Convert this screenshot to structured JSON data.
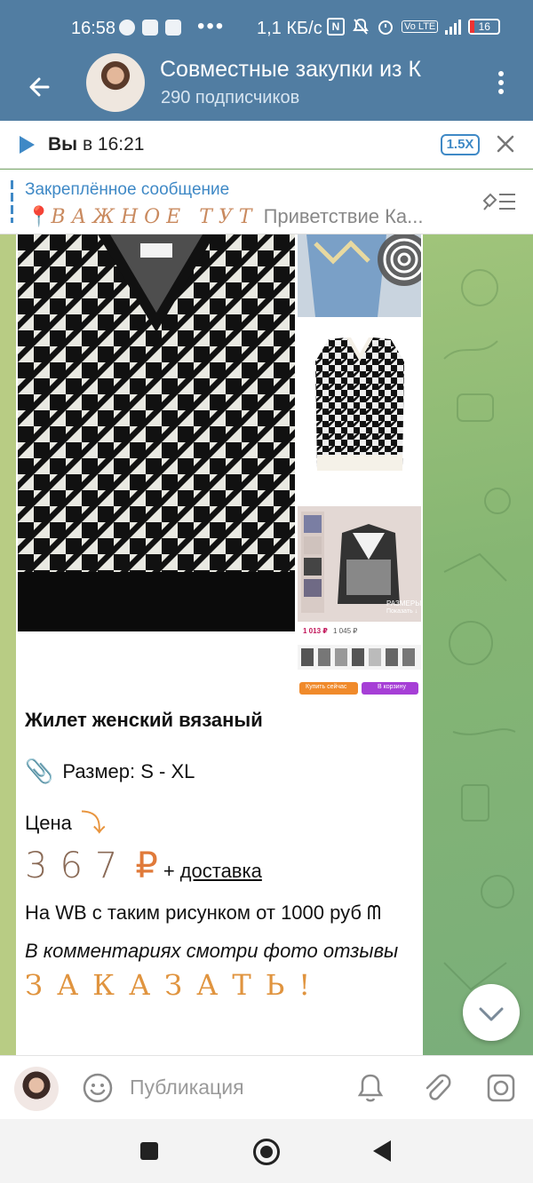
{
  "status_bar": {
    "time": "16:58",
    "dots": "•••",
    "speed": "1,1 КБ/с",
    "battery": "16",
    "volte": "Vo LTE",
    "network": "4G+"
  },
  "header": {
    "title": "Совместные закупки из К",
    "subtitle": "290 подписчиков"
  },
  "audio": {
    "sender": "Вы",
    "time_label": " в 16:21",
    "speed": "1.5X"
  },
  "pinned": {
    "title": "Закреплённое сообщение",
    "emoji": "📍",
    "fancy": "ВАЖНОЕ ТУТ",
    "preview": " Приветствие  Ка..."
  },
  "post": {
    "title": "Жилет женский вязаный",
    "size_icon": "📎",
    "size": "Размер: S - XL",
    "price_label": "Цена",
    "price_arrow": "⤵",
    "price_value": "367",
    "currency": "₽",
    "plus": "+",
    "delivery": "доставка",
    "wb_text": "На WB с таким рисунком от 1000 руб",
    "wb_emoji": "ᗰ",
    "comments": "В комментариях смотри фото отзывы",
    "order": "ЗАКАЗАТЬ!"
  },
  "side3": {
    "sizes_label": "РАЗМЕРЫ",
    "show_label": "Показать ↓",
    "price_now": "1 013 ₽",
    "price_old": "1 045 ₽",
    "btn_buy": "Купить сейчас",
    "btn_cart": "В корзину"
  },
  "input": {
    "placeholder": "Публикация"
  },
  "colors": {
    "header": "#517da2",
    "accent": "#3f89c6",
    "wallpaper": "#86b673"
  },
  "icons": [
    "back-arrow-icon",
    "more-vert-icon",
    "play-icon",
    "close-icon",
    "pin-list-icon",
    "chevron-down-icon",
    "emoji-icon",
    "bell-icon",
    "paperclip-icon",
    "camera-icon"
  ]
}
